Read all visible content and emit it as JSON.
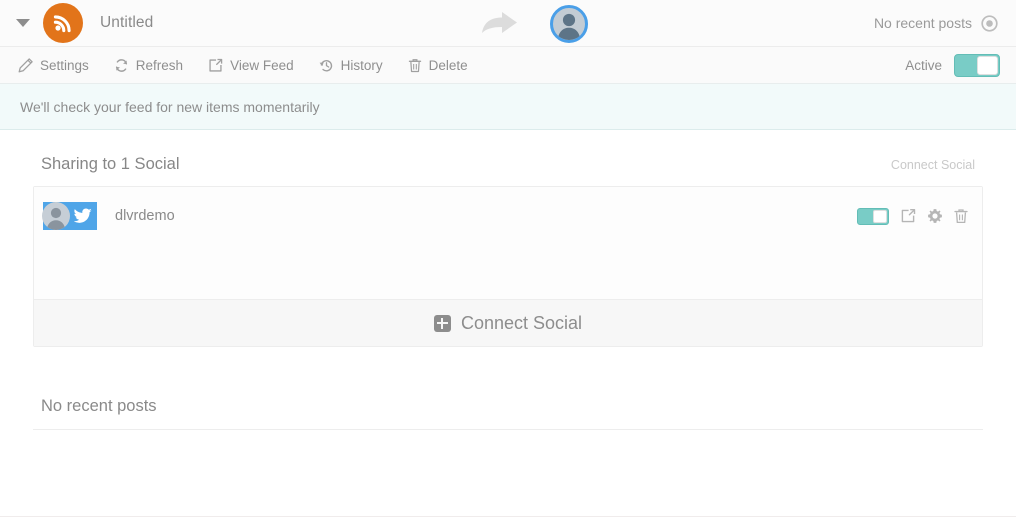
{
  "header": {
    "dropdown_icon": "chevron-down-icon",
    "feed_icon": "rss-icon",
    "feed_title": "Untitled",
    "share_icon": "share-arrow-icon",
    "avatar_icon": "user-avatar-icon",
    "status_text": "No recent posts",
    "status_icon": "target-record-icon"
  },
  "toolbar": {
    "items": [
      {
        "label": "Settings",
        "icon": "pencil-icon"
      },
      {
        "label": "Refresh",
        "icon": "refresh-icon"
      },
      {
        "label": "View Feed",
        "icon": "external-link-icon"
      },
      {
        "label": "History",
        "icon": "history-icon"
      },
      {
        "label": "Delete",
        "icon": "trash-icon"
      }
    ],
    "active_label": "Active",
    "active_toggle": "on"
  },
  "notice": {
    "text": "We'll check your feed for new items momentarily"
  },
  "sharing": {
    "title": "Sharing to 1 Social",
    "connect_link": "Connect Social",
    "accounts": [
      {
        "name": "dlvrdemo",
        "network": "twitter",
        "avatar_icon": "user-avatar-icon",
        "network_icon": "twitter-bird-icon",
        "toggle": "on",
        "actions": [
          "external-link-icon",
          "gear-icon",
          "trash-icon"
        ]
      }
    ],
    "footer_label": "Connect Social",
    "footer_icon": "plus-square-icon"
  },
  "recent": {
    "title": "No recent posts"
  },
  "colors": {
    "rss_orange": "#e2741a",
    "toggle_teal": "#79ccc6",
    "twitter_blue": "#4fa5e8",
    "avatar_border_blue": "#4a9fe8",
    "notice_bg": "#f2fafa"
  }
}
